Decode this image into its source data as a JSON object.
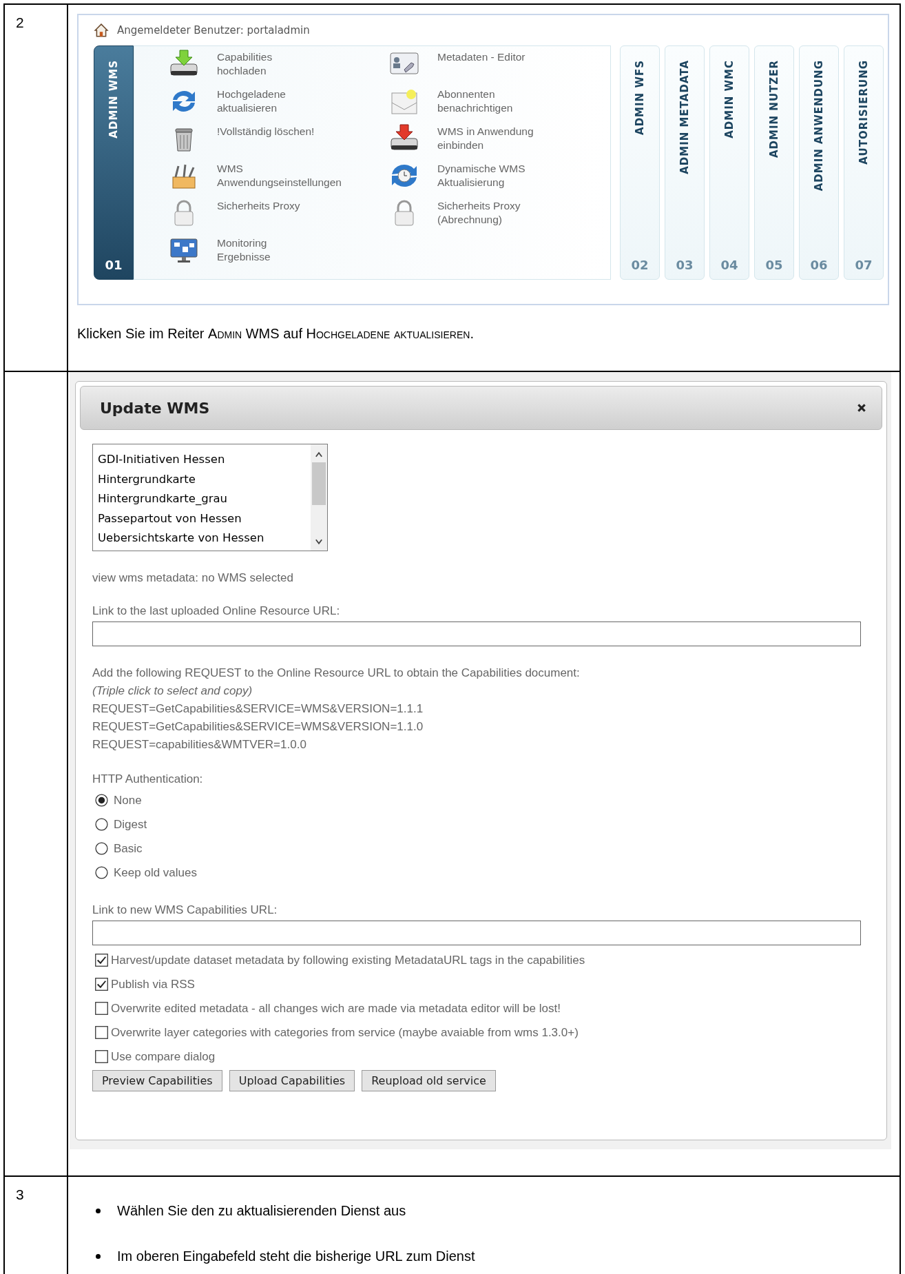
{
  "step_1": {
    "number": "2",
    "screen": {
      "user_label": "Angemeldeter Benutzer: portaladmin",
      "menu_items": [
        {
          "label": "Capabilities\nhochladen"
        },
        {
          "label": "Metadaten - Editor"
        },
        {
          "label": "Hochgeladene\naktualisieren"
        },
        {
          "label": "Abonnenten\nbenachrichtigen"
        },
        {
          "label": "!Vollständig löschen!"
        },
        {
          "label": "WMS in Anwendung\neinbinden"
        },
        {
          "label": "WMS\nAnwendungseinstellungen"
        },
        {
          "label": "Dynamische WMS\nAktualisierung"
        },
        {
          "label": "Sicherheits Proxy"
        },
        {
          "label": "Sicherheits Proxy\n(Abrechnung)"
        },
        {
          "label": "Monitoring\nErgebnisse"
        }
      ],
      "tabs": [
        {
          "label": "ADMIN WMS",
          "number": "01",
          "selected": true
        },
        {
          "label": "ADMIN WFS",
          "number": "02",
          "selected": false
        },
        {
          "label": "ADMIN METADATA",
          "number": "03",
          "selected": false
        },
        {
          "label": "ADMIN WMC",
          "number": "04",
          "selected": false
        },
        {
          "label": "ADMIN NUTZER",
          "number": "05",
          "selected": false
        },
        {
          "label": "ADMIN ANWENDUNG",
          "number": "06",
          "selected": false
        },
        {
          "label": "AUTORISIERUNG",
          "number": "07",
          "selected": false
        }
      ]
    },
    "caption": [
      {
        "text": "Klicken Sie im Reiter ",
        "kind": "plain"
      },
      {
        "text": "Admin WMS",
        "kind": "smallcaps"
      },
      {
        "text": " auf ",
        "kind": "plain"
      },
      {
        "text": "Hochgeladene aktualisieren",
        "kind": "smallcaps"
      },
      {
        "text": ".",
        "kind": "plain"
      }
    ]
  },
  "step_2": {
    "screen": {
      "dialog": {
        "title": "Update WMS",
        "services": [
          {
            "label": "GDI-Initiativen Hessen",
            "selected": false
          },
          {
            "label": "Hintergrundkarte",
            "selected": false
          },
          {
            "label": "Hintergrundkarte_grau",
            "selected": false
          },
          {
            "label": "Passepartout von Hessen",
            "selected": false
          },
          {
            "label": "Uebersichtskarte von Hessen",
            "selected": false
          }
        ],
        "metadata_status": "view wms metadata: no WMS selected",
        "last_url_label": "Link to the last uploaded Online Resource URL:",
        "request_intro": "Add the following REQUEST to the Online Resource URL to obtain the Capabilities document:",
        "request_hint": "(Triple click to select and copy)",
        "requests": [
          "REQUEST=GetCapabilities&SERVICE=WMS&VERSION=1.1.1",
          "REQUEST=GetCapabilities&SERVICE=WMS&VERSION=1.1.0",
          "REQUEST=capabilities&WMTVER=1.0.0"
        ],
        "auth_label": "HTTP Authentication:",
        "auth_options": [
          {
            "label": "None",
            "selected": true
          },
          {
            "label": "Digest",
            "selected": false
          },
          {
            "label": "Basic",
            "selected": false
          },
          {
            "label": "Keep old values",
            "selected": false
          }
        ],
        "new_url_label": "Link to new WMS Capabilities URL:",
        "options": [
          {
            "label": "Harvest/update dataset metadata by following existing MetadataURL tags in the capabilities",
            "checked": true
          },
          {
            "label": "Publish via RSS",
            "checked": true
          },
          {
            "label": "Overwrite edited metadata - all changes wich are made via metadata editor will be lost!",
            "checked": false
          },
          {
            "label": "Overwrite layer categories with categories from service (maybe avaiable from wms 1.3.0+)",
            "checked": false
          },
          {
            "label": "Use compare dialog",
            "checked": false
          }
        ],
        "buttons": [
          "Preview Capabilities",
          "Upload Capabilities",
          "Reupload old service"
        ]
      }
    }
  },
  "step_3": {
    "number": "3",
    "bullets": [
      "Wählen Sie den zu aktualisierenden Dienst aus",
      "Im oberen Eingabefeld steht die bisherige URL zum Dienst"
    ]
  }
}
